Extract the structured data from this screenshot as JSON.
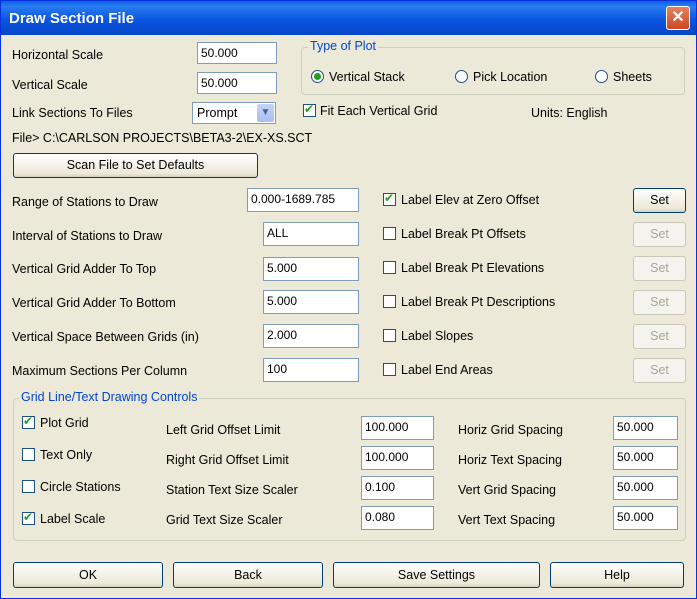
{
  "window": {
    "title": "Draw Section File",
    "close_label": "✕"
  },
  "scale": {
    "horizontal_label": "Horizontal Scale",
    "horizontal_value": "50.000",
    "vertical_label": "Vertical Scale",
    "vertical_value": "50.000",
    "link_label": "Link Sections To Files",
    "link_value": "Prompt",
    "fit_label": "Fit Each Vertical Grid",
    "file_text": "File> C:\\CARLSON PROJECTS\\BETA3-2\\EX-XS.SCT",
    "scan_button": "Scan File to Set Defaults"
  },
  "plot_type": {
    "legend": "Type of Plot",
    "options": [
      "Vertical Stack",
      "Pick Location",
      "Sheets"
    ],
    "selected": "Vertical Stack",
    "units": "Units: English"
  },
  "stations": {
    "range_label": "Range of Stations to Draw",
    "range_value": "0.000-1689.785",
    "interval_label": "Interval of Stations to Draw",
    "interval_value": "ALL",
    "adder_top_label": "Vertical Grid Adder To Top",
    "adder_top_value": "5.000",
    "adder_bottom_label": "Vertical Grid Adder To Bottom",
    "adder_bottom_value": "5.000",
    "space_label": "Vertical Space Between Grids (in)",
    "space_value": "2.000",
    "max_label": "Maximum Sections Per Column",
    "max_value": "100"
  },
  "labels": [
    {
      "text": "Label Elev at Zero Offset",
      "checked": true,
      "set": "Set"
    },
    {
      "text": "Label Break Pt Offsets",
      "checked": false,
      "set": "Set"
    },
    {
      "text": "Label Break Pt Elevations",
      "checked": false,
      "set": "Set"
    },
    {
      "text": "Label Break Pt Descriptions",
      "checked": false,
      "set": "Set"
    },
    {
      "text": "Label Slopes",
      "checked": false,
      "set": "Set"
    },
    {
      "text": "Label End Areas",
      "checked": false,
      "set": "Set"
    }
  ],
  "grid": {
    "legend": "Grid Line/Text Drawing Controls",
    "checks": [
      {
        "text": "Plot Grid",
        "checked": true
      },
      {
        "text": "Text Only",
        "checked": false
      },
      {
        "text": "Circle Stations",
        "checked": false
      },
      {
        "text": "Label Scale",
        "checked": true
      }
    ],
    "middle": [
      {
        "label": "Left Grid Offset Limit",
        "value": "100.000"
      },
      {
        "label": "Right Grid Offset Limit",
        "value": "100.000"
      },
      {
        "label": "Station Text Size Scaler",
        "value": "0.100"
      },
      {
        "label": "Grid Text Size Scaler",
        "value": "0.080"
      }
    ],
    "right": [
      {
        "label": "Horiz Grid Spacing",
        "value": "50.000"
      },
      {
        "label": "Horiz Text Spacing",
        "value": "50.000"
      },
      {
        "label": "Vert Grid Spacing",
        "value": "50.000"
      },
      {
        "label": "Vert Text Spacing",
        "value": "50.000"
      }
    ]
  },
  "footer": {
    "ok": "OK",
    "back": "Back",
    "save": "Save Settings",
    "help": "Help"
  },
  "icons": {
    "close": "close-icon",
    "check": "check-icon",
    "dropdown": "chevron-down-icon"
  }
}
